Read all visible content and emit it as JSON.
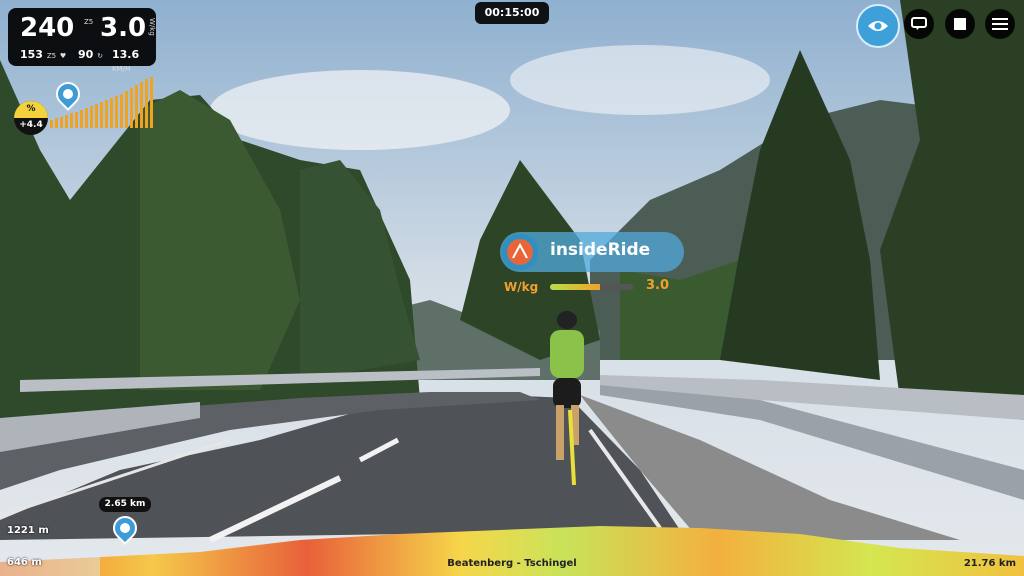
{
  "stats": {
    "power": "240",
    "power_zone": "Z5",
    "wkg": "3.0",
    "wkg_unit": "W/kg",
    "heart_rate": "153",
    "hr_zone": "Z5",
    "cadence": "90",
    "speed": "13.6",
    "speed_unit": "KM/H"
  },
  "grade": {
    "symbol": "%",
    "value": "+4.4"
  },
  "timer": "00:15:00",
  "rider": {
    "name": "insideRide",
    "wkg_label": "W/kg",
    "wkg_value": "3.0",
    "wkg_fraction": 0.6
  },
  "elevation": {
    "top": "1221 m",
    "bottom": "646 m",
    "position_label": "2.65 km",
    "route_name": "Beatenberg - Tschingel",
    "total_distance": "21.76 km"
  },
  "icons": {
    "view": "eye-icon",
    "chat": "chat-icon",
    "stop": "stop-icon",
    "menu": "hamburger-menu-icon"
  },
  "colors": {
    "accent_blue": "#3da0d8",
    "grade_yellow": "#f3d23c",
    "wkg_orange": "#f3a02a"
  }
}
